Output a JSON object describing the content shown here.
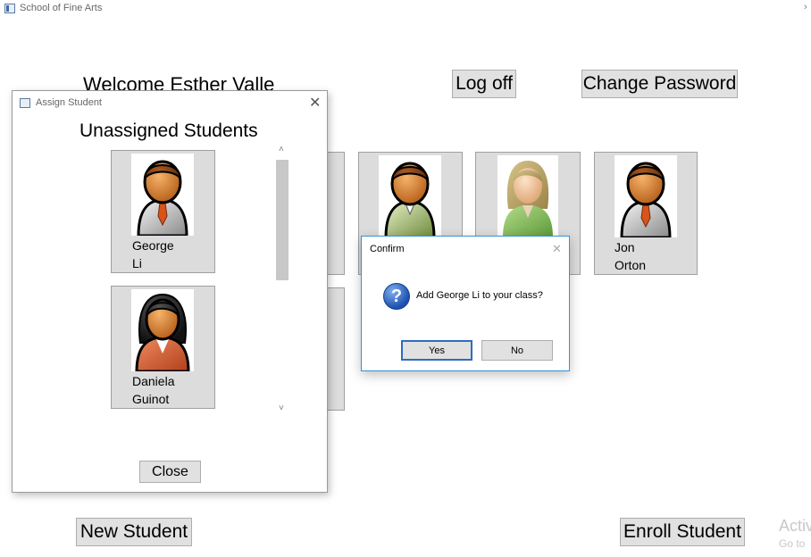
{
  "window": {
    "title": "School of Fine Arts",
    "chevron": "›"
  },
  "header": {
    "welcome": "Welcome Esther Valle",
    "logoff_label": "Log off",
    "change_password_label": "Change Password"
  },
  "class_tiles": [
    {
      "first": "",
      "last": "",
      "avatar": "partial"
    },
    {
      "first": "",
      "last": "",
      "avatar": "male-green"
    },
    {
      "first": "",
      "last": "",
      "avatar": "female-green"
    },
    {
      "first": "Jon",
      "last": "Orton",
      "avatar": "male-brown"
    }
  ],
  "footer": {
    "new_student_label": "New Student",
    "enroll_student_label": "Enroll Student"
  },
  "watermark": {
    "line1": "Activ",
    "line2": "Go to"
  },
  "assign_dialog": {
    "title": "Assign Student",
    "close_glyph": "✕",
    "heading": "Unassigned Students",
    "students": [
      {
        "first": "George",
        "last": "Li",
        "avatar": "male-brown"
      },
      {
        "first": "Daniela",
        "last": "Guinot",
        "avatar": "female-red"
      }
    ],
    "close_button_label": "Close",
    "scroll_up": "˄",
    "scroll_down": "˅"
  },
  "confirm_dialog": {
    "title": "Confirm",
    "close_glyph": "✕",
    "icon_glyph": "?",
    "message": "Add George Li to your class?",
    "yes_label": "Yes",
    "no_label": "No"
  },
  "colors": {
    "tile_bg": "#dcdcdc",
    "button_bg": "#e1e1e1",
    "accent": "#2d6dbd"
  }
}
